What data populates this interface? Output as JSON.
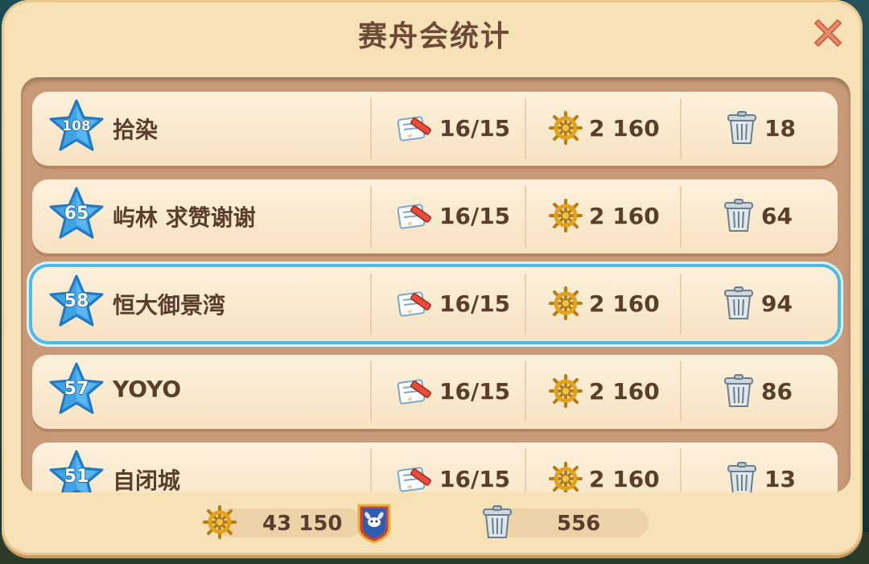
{
  "dialog": {
    "title": "赛舟会统计"
  },
  "members": [
    {
      "level": "108",
      "name": "拾染",
      "tasks": "16/15",
      "points": "2 160",
      "trash": "18",
      "highlighted": false
    },
    {
      "level": "65",
      "name": "屿林 求赞谢谢",
      "tasks": "16/15",
      "points": "2 160",
      "trash": "64",
      "highlighted": false
    },
    {
      "level": "58",
      "name": "恒大御景湾",
      "tasks": "16/15",
      "points": "2 160",
      "trash": "94",
      "highlighted": true
    },
    {
      "level": "57",
      "name": "YOYO",
      "tasks": "16/15",
      "points": "2 160",
      "trash": "86",
      "highlighted": false
    },
    {
      "level": "51",
      "name": "自闭城",
      "tasks": "16/15",
      "points": "2 160",
      "trash": "13",
      "highlighted": false
    }
  ],
  "footer": {
    "total_points": "43 150",
    "total_trash": "556"
  },
  "icons": {
    "close": "close-icon",
    "level": "star-level-icon",
    "tasks": "task-pencil-icon",
    "points": "ship-wheel-icon",
    "trash": "trash-can-icon",
    "club": "club-badge-icon"
  },
  "colors": {
    "highlight": "#4fb9ea",
    "star": "#3fa3e6",
    "text": "#5b3d2e",
    "panel": "#f7e1b7"
  }
}
